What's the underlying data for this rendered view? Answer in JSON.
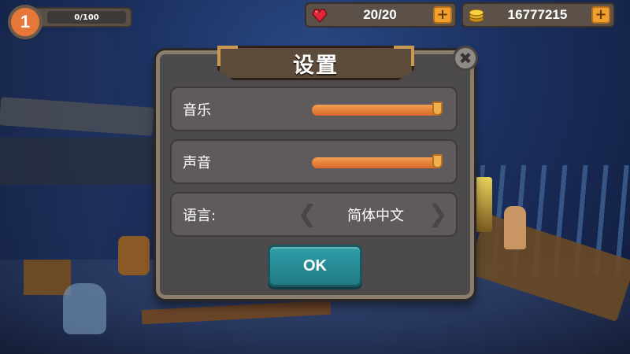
{
  "hud": {
    "level": "1",
    "xp_text": "0/100",
    "xp_progress": 0,
    "hearts": {
      "value": "20/20",
      "icon": "heart-icon",
      "plus": "+"
    },
    "coins": {
      "value": "16777215",
      "icon": "coin-stack-icon",
      "plus": "+"
    }
  },
  "dialog": {
    "title": "设置",
    "close_icon": "close-icon",
    "music": {
      "label": "音乐",
      "level": 1.0
    },
    "sound": {
      "label": "声音",
      "level": 1.0
    },
    "language": {
      "label": "语言:",
      "value": "简体中文",
      "prev_icon": "chevron-left-icon",
      "next_icon": "chevron-right-icon"
    },
    "ok_label": "OK"
  },
  "colors": {
    "accent": "#e8773a",
    "ok_button": "#2b8f9a",
    "slider_fill": "#e47a3a",
    "panel": "#4d4a4c"
  }
}
